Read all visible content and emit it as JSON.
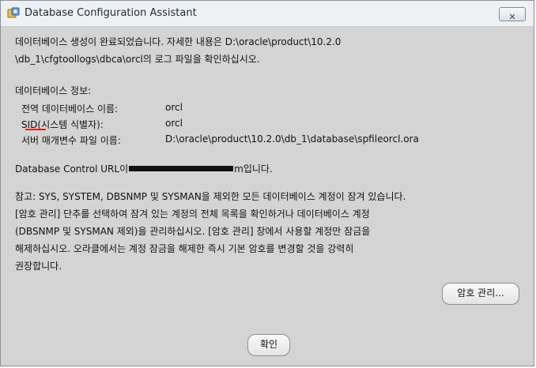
{
  "window": {
    "title": "Database Configuration Assistant",
    "app_icon": "dbca-app-icon",
    "close_icon": "close-icon"
  },
  "message": {
    "line1": "데이터베이스 생성이 완료되었습니다. 자세한 내용은 D:\\oracle\\product\\10.2.0",
    "line2": "\\db_1\\cfgtoollogs\\dbca\\orcl의 로그 파일을 확인하십시오."
  },
  "db_info": {
    "heading": "데이터베이스 정보:",
    "global_name_label": "전역 데이터베이스 이름:",
    "global_name_value": "orcl",
    "sid_label": "SID(시스템 식별자):",
    "sid_value": "orcl",
    "param_file_label": "서버 매개변수 파일 이름:",
    "param_file_value": "D:\\oracle\\product\\10.2.0\\db_1\\database\\spfileorcl.ora"
  },
  "control_url": {
    "prefix": "Database Control URL이",
    "suffix": "m입니다."
  },
  "note": {
    "line1": "참고: SYS, SYSTEM, DBSNMP 및 SYSMAN을 제외한 모든 데이터베이스 계정이 잠겨 있습니다.",
    "line2": "[암호 관리] 단추를 선택하여 잠겨 있는 계정의 전체 목록을 확인하거나 데이터베이스 계정",
    "line3": "(DBSNMP 및 SYSMAN 제외)을 관리하십시오. [암호 관리] 창에서 사용할 계정만 잠금을",
    "line4": "해제하십시오. 오라클에서는 계정 잠금을 해제한 즉시 기본 암호를 변경할 것을 강력히",
    "line5": "권장합니다."
  },
  "buttons": {
    "password_manage": "암호 관리...",
    "ok": "확인"
  },
  "colors": {
    "title_bar": "#eef1f4",
    "body": "#d4d4d4",
    "sid_underline": "#e02222"
  }
}
